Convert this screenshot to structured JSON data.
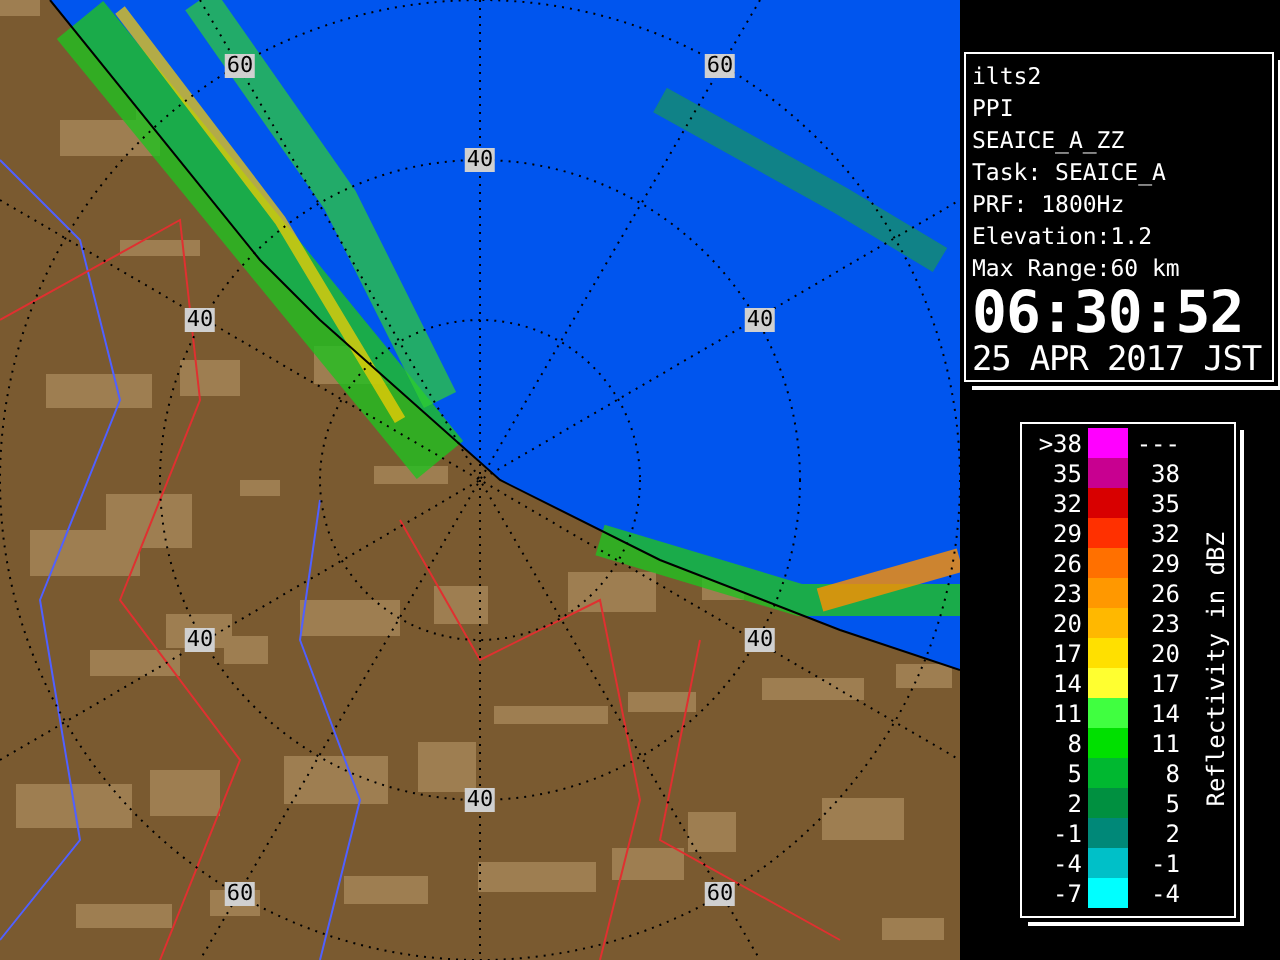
{
  "map": {
    "range_labels": [
      "60",
      "60",
      "40",
      "40",
      "40",
      "40",
      "40",
      "40",
      "60",
      "60"
    ]
  },
  "info": {
    "lines": [
      "ilts2",
      "PPI",
      "SEAICE_A_ZZ",
      "Task: SEAICE_A",
      "PRF: 1800Hz",
      "Elevation:1.2",
      "Max Range:60 km"
    ],
    "time": "06:30:52",
    "date": "25 APR 2017 JST"
  },
  "legend": {
    "title": "Reflectivity in dBZ",
    "rows": [
      {
        "low": ">38",
        "high": "---",
        "color": "#ff00ff"
      },
      {
        "low": "35",
        "high": "38",
        "color": "#c80090"
      },
      {
        "low": "32",
        "high": "35",
        "color": "#d80000"
      },
      {
        "low": "29",
        "high": "32",
        "color": "#ff3000"
      },
      {
        "low": "26",
        "high": "29",
        "color": "#ff7000"
      },
      {
        "low": "23",
        "high": "26",
        "color": "#ff9800"
      },
      {
        "low": "20",
        "high": "23",
        "color": "#ffb800"
      },
      {
        "low": "17",
        "high": "20",
        "color": "#ffe000"
      },
      {
        "low": "14",
        "high": "17",
        "color": "#ffff30"
      },
      {
        "low": "11",
        "high": "14",
        "color": "#40ff40"
      },
      {
        "low": "8",
        "high": "11",
        "color": "#00e000"
      },
      {
        "low": "5",
        "high": "8",
        "color": "#00b830"
      },
      {
        "low": "2",
        "high": "5",
        "color": "#009040"
      },
      {
        "low": "-1",
        "high": "2",
        "color": "#008878"
      },
      {
        "low": "-4",
        "high": "-1",
        "color": "#00c0c8"
      },
      {
        "low": "-7",
        "high": "-4",
        "color": "#00ffff"
      }
    ]
  }
}
